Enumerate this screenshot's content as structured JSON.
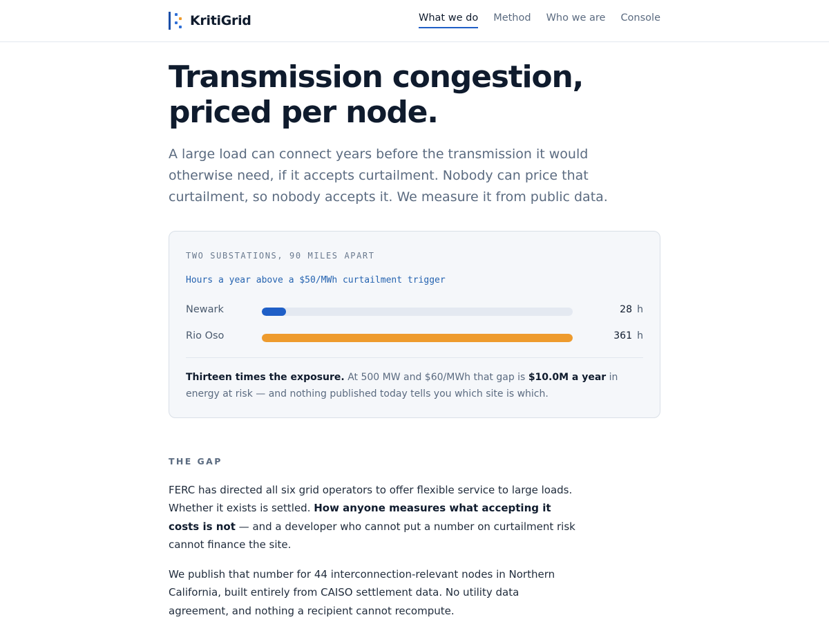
{
  "header": {
    "brand": "KritiGrid",
    "nav": [
      {
        "label": "What we do",
        "active": true
      },
      {
        "label": "Method",
        "active": false
      },
      {
        "label": "Who we are",
        "active": false
      },
      {
        "label": "Console",
        "active": false
      }
    ]
  },
  "hero": {
    "title_line1": "Transmission congestion,",
    "title_line2": "priced per node.",
    "lede": "A large load can connect years before the transmission it would otherwise need, if it accepts curtailment. Nobody can price that curtailment, so nobody accepts it. We measure it from public data."
  },
  "comparison": {
    "eyebrow": "TWO SUBSTATIONS, 90 MILES APART",
    "subtitle": "Hours a year above a $50/MWh curtailment trigger",
    "unit": "h",
    "max_value": 361,
    "rows": [
      {
        "name": "Newark",
        "value": 28,
        "color": "#1f5fc7"
      },
      {
        "name": "Rio Oso",
        "value": 361,
        "color": "#ee9b2d"
      }
    ],
    "note_strong": "Thirteen times the exposure.",
    "note_part1": " At 500 MW and $60/MWh that gap is ",
    "note_amount": "$10.0M a year",
    "note_part2": " in energy at risk — and nothing published today tells you which site is which."
  },
  "gap_section": {
    "eyebrow": "THE GAP",
    "p1_part1": "FERC has directed all six grid operators to offer flexible service to large loads. Whether it exists is settled. ",
    "p1_strong": "How anyone measures what accepting it costs is not",
    "p1_part2": " — and a developer who cannot put a number on curtailment risk cannot finance the site.",
    "p2": "We publish that number for 44 interconnection-relevant nodes in Northern California, built entirely from CAISO settlement data. No utility data agreement, and nothing a recipient cannot recompute."
  },
  "colors": {
    "accent_blue": "#1f5fc7",
    "accent_orange": "#ee9b2d",
    "logo_dot_blue": "#2f6fd6",
    "logo_dot_orange": "#ee9b2d"
  }
}
